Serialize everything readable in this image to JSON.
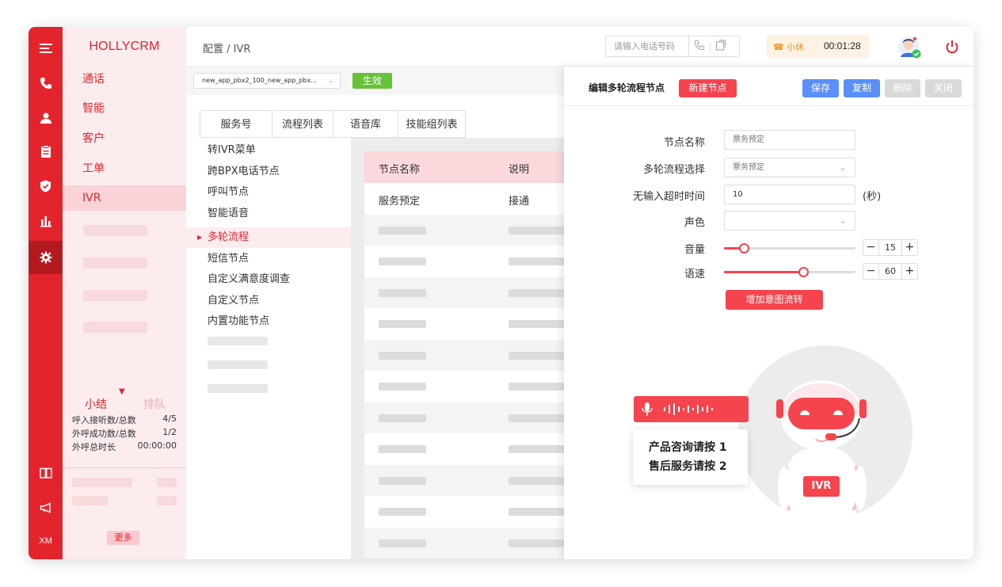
{
  "app": {
    "brand": "HOLLYCRM"
  },
  "colors": {
    "primary": "#e3242d",
    "blue": "#5b8ff9",
    "green": "#67c23a",
    "orange": "#f5900d"
  },
  "rail": {
    "icons": [
      "menu-icon",
      "phone-icon",
      "user-icon",
      "clipboard-icon",
      "shield-icon",
      "bar-chart-icon",
      "gear-icon",
      "book-icon",
      "megaphone-icon"
    ],
    "footer_label": "XM"
  },
  "nav": {
    "items": [
      {
        "label": "通话"
      },
      {
        "label": "智能"
      },
      {
        "label": "客户"
      },
      {
        "label": "工单"
      },
      {
        "label": "IVR"
      }
    ],
    "stats": {
      "tab_summary": "小结",
      "tab_queue": "排队",
      "rows": [
        {
          "label": "呼入接听数/总数",
          "value": "4/5"
        },
        {
          "label": "外呼成功数/总数",
          "value": "1/2"
        },
        {
          "label": "外呼总时长",
          "value": "00:00:00"
        }
      ]
    },
    "more_label": "更多"
  },
  "header": {
    "breadcrumb": "配置 / IVR",
    "phone_placeholder": "请输入电话号码",
    "status_label": "小休",
    "timer": "00:01:28"
  },
  "config": {
    "select_value": "new_app_pbx2_100_new_app_pbx...",
    "apply_label": "生效",
    "tabs": [
      "服务号",
      "流程列表",
      "语音库",
      "技能组列表"
    ],
    "tree": [
      "转IVR菜单",
      "跨BPX电话节点",
      "呼叫节点",
      "智能语音",
      "多轮流程",
      "短信节点",
      "自定义满意度调查",
      "自定义节点",
      "内置功能节点"
    ],
    "table": {
      "headers": [
        "节点名称",
        "说明"
      ],
      "rows": [
        [
          "服务预定",
          "接通"
        ]
      ]
    }
  },
  "panel": {
    "title": "编辑多轮流程节点",
    "new_node_label": "新建节点",
    "save_label": "保存",
    "copy_label": "复制",
    "delete_label": "删除",
    "close_label": "关闭",
    "fields": {
      "node_name_label": "节点名称",
      "node_name_placeholder": "票务预定",
      "flow_label": "多轮流程选择",
      "flow_value": "票务预定",
      "timeout_label": "无输入超时时间",
      "timeout_value": "10",
      "timeout_unit": "(秒)",
      "voice_label": "声色",
      "volume_label": "音量",
      "volume_value": "15",
      "speed_label": "语速",
      "speed_value": "60"
    },
    "add_intent_label": "增加意图流转",
    "illustration": {
      "badge": "IVR",
      "line1": "产品咨询请按 1",
      "line2": "售后服务请按 2"
    }
  }
}
